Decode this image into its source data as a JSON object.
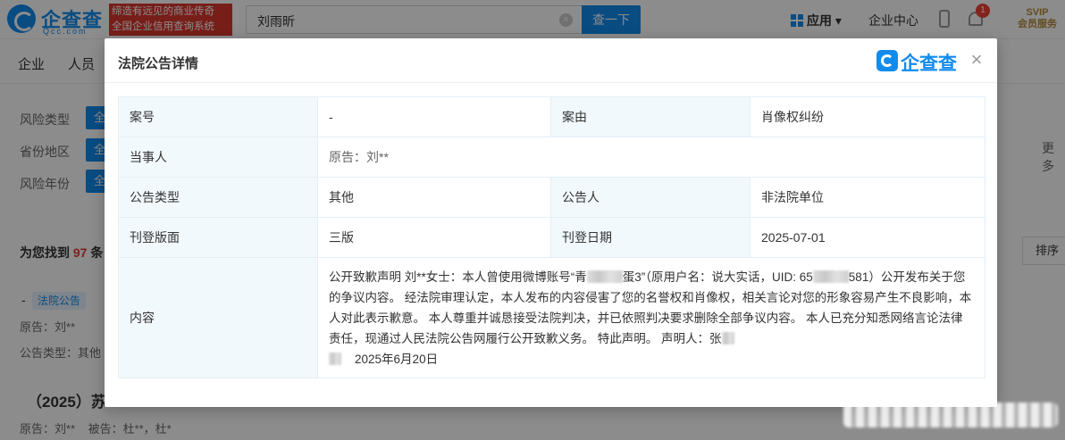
{
  "header": {
    "logo_name": "企查查",
    "logo_domain": "Qcc.com",
    "slogan_line1": "缔造有远见的商业传奇",
    "slogan_line2": "全国企业信用查询系统",
    "search_value": "刘雨昕",
    "search_button": "查一下",
    "app_menu": "应用",
    "enterprise_center": "企业中心",
    "notification_count": "1",
    "svip_line1": "SVIP",
    "svip_line2": "会员服务"
  },
  "nav": {
    "items": [
      "企业",
      "人员"
    ]
  },
  "filters": [
    {
      "label": "风险类型",
      "chip": "全"
    },
    {
      "label": "省份地区",
      "chip": "全"
    },
    {
      "label": "风险年份",
      "chip": "全"
    }
  ],
  "more": "更多",
  "results": {
    "prefix": "为您找到",
    "count": "97",
    "suffix": "条",
    "sort": "排序",
    "item1": {
      "dash": "-",
      "tag": "法院公告",
      "plaintiff": "原告：刘**",
      "type": "公告类型：其他"
    },
    "item2": {
      "title": "（2025）苏",
      "parties": "原告：刘**    被告：杜**，杜*"
    }
  },
  "modal": {
    "title": "法院公告详情",
    "logo_text": "企查查",
    "close": "×",
    "rows": {
      "case_no_label": "案号",
      "case_no": "-",
      "cause_label": "案由",
      "cause": "肖像权纠纷",
      "party_label": "当事人",
      "party": "原告：刘**",
      "type_label": "公告类型",
      "type": "其他",
      "announcer_label": "公告人",
      "announcer": "非法院单位",
      "edition_label": "刊登版面",
      "edition": "三版",
      "date_label": "刊登日期",
      "date": "2025-07-01",
      "content_label": "内容",
      "content_p1": "公开致歉声明 刘**女士：本人曾使用微博账号“青",
      "content_p2": "蛋3”（原用户名：说大实话，UID: 65",
      "content_p3": "581）公开发布关于您的争议内容。 经法院审理认定，本人发布的内容侵害了您的名誉权和肖像权，相关言论对您的形象容易产生不良影响，本人对此表示歉意。 本人尊重并诚恳接受法院判决，并已依照判决要求删除全部争议内容。 本人已充分知悉网络言论法律责任，现通过人民法院公告网履行公开致歉义务。 特此声明。 声明人：张",
      "content_p4": "2025年6月20日"
    }
  }
}
